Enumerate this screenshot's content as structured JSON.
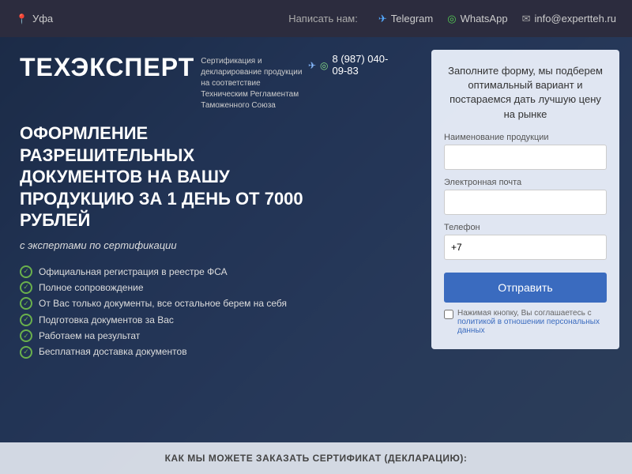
{
  "topbar": {
    "city": "Уфа",
    "write_to_us": "Написать нам:",
    "telegram_label": "Telegram",
    "whatsapp_label": "WhatsApp",
    "email_label": "info@expertteh.ru"
  },
  "hero": {
    "logo": "ТЕХЭКСПЕРТ",
    "logo_subtitle": "Сертификация и декларирование продукции на соответствие Техническим Регламентам Таможенного Союза",
    "phone": "8 (987) 040-09-83",
    "headline": "ОФОРМЛЕНИЕ РАЗРЕШИТЕЛЬНЫХ ДОКУМЕНТОВ НА ВАШУ ПРОДУКЦИЮ ЗА 1 ДЕНЬ ОТ 7000 РУБЛЕЙ",
    "subtext": "с экспертами по сертификации",
    "features": [
      "Официальная регистрация в реестре ФСА",
      "Полное сопровождение",
      "От Вас только документы, все остальное берем на себя",
      "Подготовка документов за Вас",
      "Работаем на результат",
      "Бесплатная доставка документов"
    ],
    "form": {
      "title": "Заполните форму, мы подберем оптимальный вариант и постараемся дать лучшую цену на рынке",
      "field1_label": "Наименование продукции",
      "field1_placeholder": "",
      "field2_label": "Электронная почта",
      "field2_placeholder": "",
      "field3_label": "Телефон",
      "field3_value": "+7",
      "submit_label": "Отправить",
      "privacy_text": "Нажимая кнопку, Вы соглашаетесь с",
      "privacy_link_text": "политикой в отношении персональных данных"
    }
  },
  "bottom": {
    "text": "КАК МЫ МОЖЕТЕ ЗАКАЗАТЬ СЕРТИФИКАТ (ДЕКЛАРАЦИЮ):"
  }
}
